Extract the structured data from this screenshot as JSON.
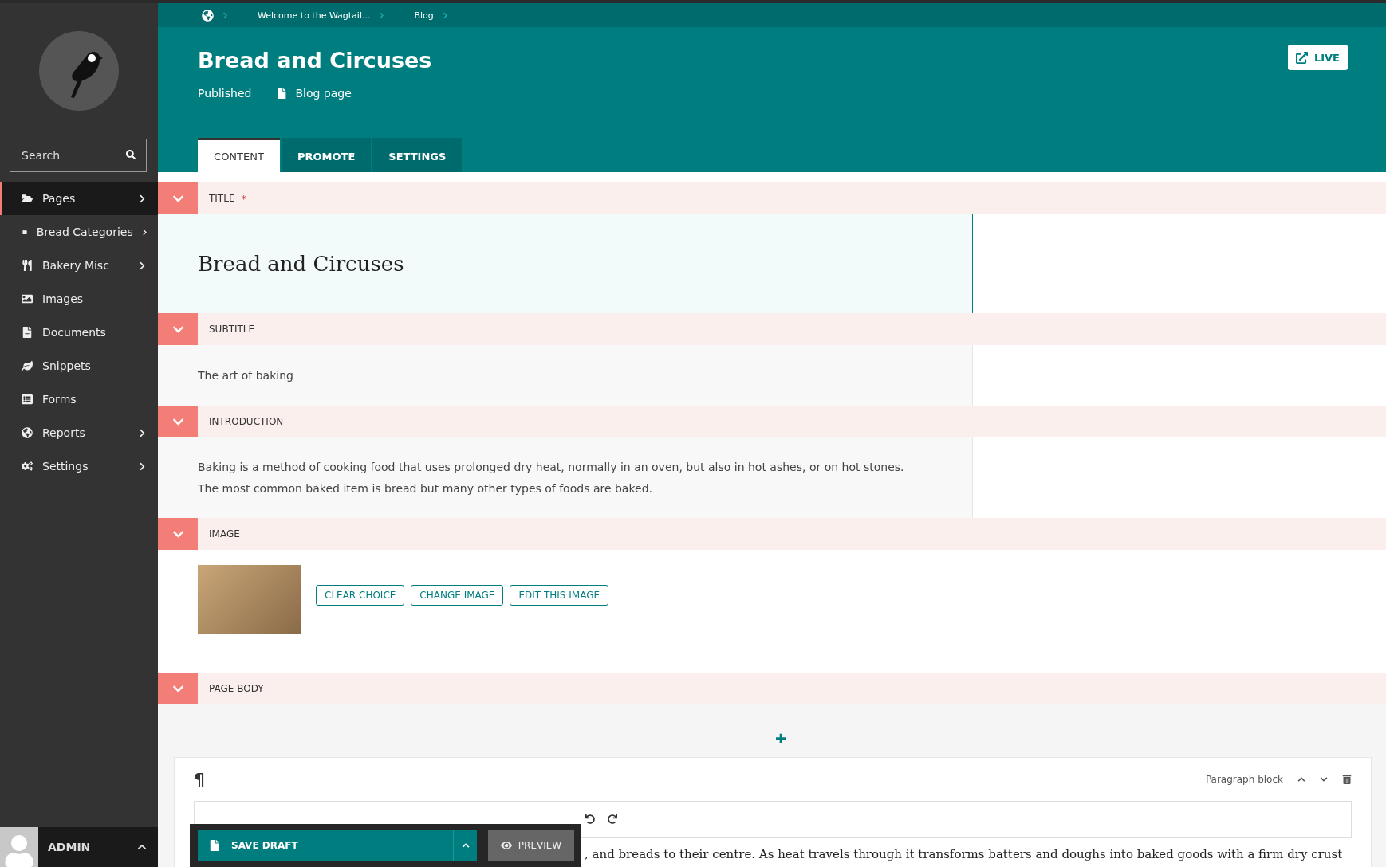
{
  "breadcrumb": [
    {
      "kind": "home"
    },
    {
      "kind": "link",
      "label": "Welcome to the Wagtail..."
    },
    {
      "kind": "link",
      "label": "Blog"
    }
  ],
  "sidebar": {
    "search": {
      "placeholder": "Search"
    },
    "items": [
      {
        "label": "Pages",
        "selected": true,
        "submenu": true
      },
      {
        "label": "Bread Categories",
        "selected": false,
        "submenu": true
      },
      {
        "label": "Bakery Misc",
        "selected": false,
        "submenu": true
      },
      {
        "label": "Images",
        "selected": false,
        "submenu": false
      },
      {
        "label": "Documents",
        "selected": false,
        "submenu": false
      },
      {
        "label": "Snippets",
        "selected": false,
        "submenu": false
      },
      {
        "label": "Forms",
        "selected": false,
        "submenu": false
      },
      {
        "label": "Reports",
        "selected": false,
        "submenu": true
      },
      {
        "label": "Settings",
        "selected": false,
        "submenu": true
      }
    ],
    "user": {
      "name": "ADMIN"
    }
  },
  "header": {
    "title": "Bread and Circuses",
    "status": "Published",
    "page_type": "Blog page",
    "live_button": "LIVE"
  },
  "tabs": [
    {
      "label": "CONTENT",
      "selected": true
    },
    {
      "label": "PROMOTE",
      "selected": false
    },
    {
      "label": "SETTINGS",
      "selected": false
    }
  ],
  "fields": [
    {
      "kind": "title",
      "label": "TITLE",
      "required_mark": "*",
      "value": "Bread and Circuses",
      "focused": true
    },
    {
      "kind": "text",
      "label": "SUBTITLE",
      "value": "The art of baking",
      "focused": false
    },
    {
      "kind": "textarea",
      "label": "INTRODUCTION",
      "value": "Baking is a method of cooking food that uses prolonged dry heat, normally in an oven, but also in hot ashes, or on hot stones. The most common baked item is bread but many other types of foods are baked.",
      "focused": false
    },
    {
      "kind": "image",
      "label": "IMAGE",
      "buttons": [
        "CLEAR CHOICE",
        "CHANGE IMAGE",
        "EDIT THIS IMAGE"
      ]
    },
    {
      "kind": "streamfield",
      "label": "PAGE BODY",
      "add_symbol": "+",
      "block": {
        "symbol": "¶",
        "label": "Paragraph block",
        "text": ", and breads to their centre. As heat travels through it transforms batters and doughs into baked goods with a firm dry crust"
      }
    }
  ],
  "footer": {
    "save_button": "SAVE DRAFT",
    "preview_button": "PREVIEW"
  }
}
